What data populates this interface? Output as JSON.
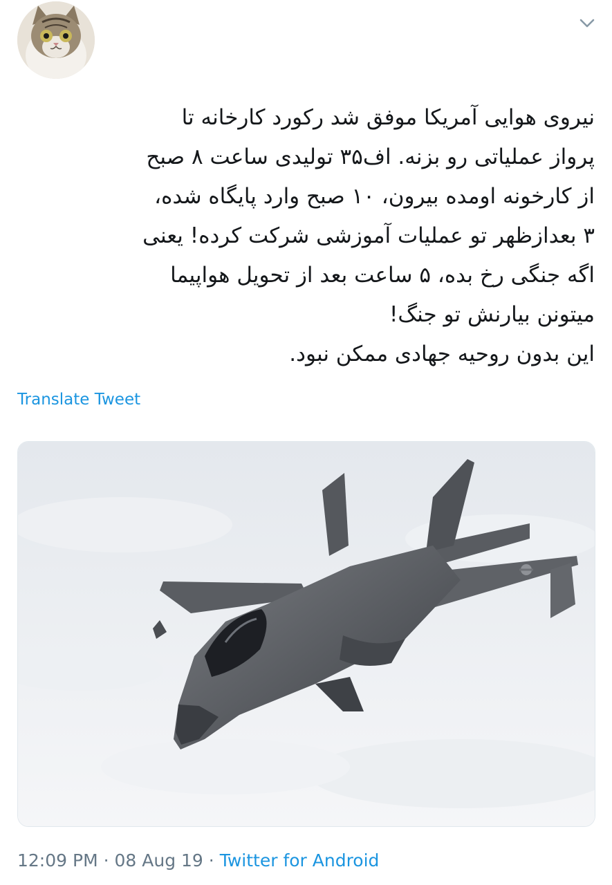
{
  "tweet": {
    "avatar_icon": "cat-avatar",
    "menu_icon": "chevron-down-icon",
    "text": "نیروی هوایی آمریکا موفق شد رکورد کارخانه تا\nپرواز عملیاتی رو بزنه. اف۳۵ تولیدی ساعت ۸ صبح\nاز کارخونه اومده بیرون، ۱۰ صبح وارد پایگاه شده،\n۳ بعدازظهر تو عملیات آموزشی شرکت کرده! یعنی\nاگه جنگی رخ بده، ۵ ساعت بعد از تحویل هواپیما\nمیتونن بیارنش تو جنگ!\nاین بدون روحیه جهادی ممکن نبود.",
    "translate_label": "Translate Tweet",
    "time": "12:09 PM",
    "separator": "·",
    "date": "08 Aug 19",
    "source": "Twitter for Android",
    "colors": {
      "text": "#14171a",
      "link": "#1b95e0",
      "muted": "#657786"
    }
  }
}
